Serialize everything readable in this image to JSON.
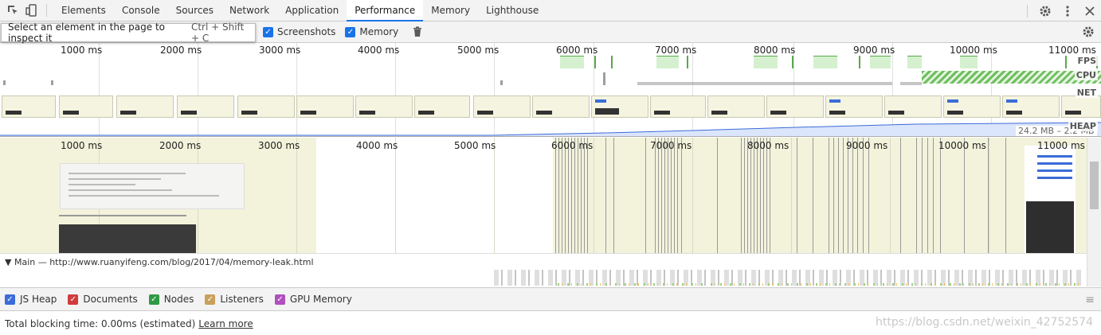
{
  "tabs": [
    "Elements",
    "Console",
    "Sources",
    "Network",
    "Application",
    "Performance",
    "Memory",
    "Lighthouse"
  ],
  "active_tab": "Performance",
  "toolbar": {
    "tooltip_text": "Select an element in the page to inspect it",
    "tooltip_shortcut": "Ctrl + Shift + C",
    "screenshots_label": "Screenshots",
    "memory_label": "Memory"
  },
  "overview": {
    "ticks": [
      "1000 ms",
      "2000 ms",
      "3000 ms",
      "4000 ms",
      "5000 ms",
      "6000 ms",
      "7000 ms",
      "8000 ms",
      "9000 ms",
      "10000 ms",
      "11000 ms"
    ],
    "tracks": [
      "FPS",
      "CPU",
      "NET",
      "HEAP"
    ],
    "heap_range": "24.2 MB – 2.2 MB"
  },
  "flame": {
    "ticks": [
      "1000 ms",
      "2000 ms",
      "3000 ms",
      "4000 ms",
      "5000 ms",
      "6000 ms",
      "7000 ms",
      "8000 ms",
      "9000 ms",
      "10000 ms",
      "11000 ms"
    ]
  },
  "main": {
    "title": "▼ Main — http://www.ruanyifeng.com/blog/2017/04/memory-leak.html"
  },
  "counters": [
    {
      "label": "JS Heap",
      "color": "#3b6cd8"
    },
    {
      "label": "Documents",
      "color": "#d03c3c"
    },
    {
      "label": "Nodes",
      "color": "#2f9a44"
    },
    {
      "label": "Listeners",
      "color": "#c9a05a"
    },
    {
      "label": "GPU Memory",
      "color": "#b04fc0"
    }
  ],
  "footer": {
    "text": "Total blocking time: 0.00ms (estimated)",
    "link": "Learn more",
    "watermark": "https://blog.csdn.net/weixin_42752574"
  },
  "icons": {
    "inspect": "inspect-icon",
    "device": "device-toolbar-icon",
    "settings": "gear-icon",
    "more": "more-vert-icon",
    "close": "close-icon",
    "trash": "trash-icon",
    "capture_settings": "capture-settings-icon"
  }
}
